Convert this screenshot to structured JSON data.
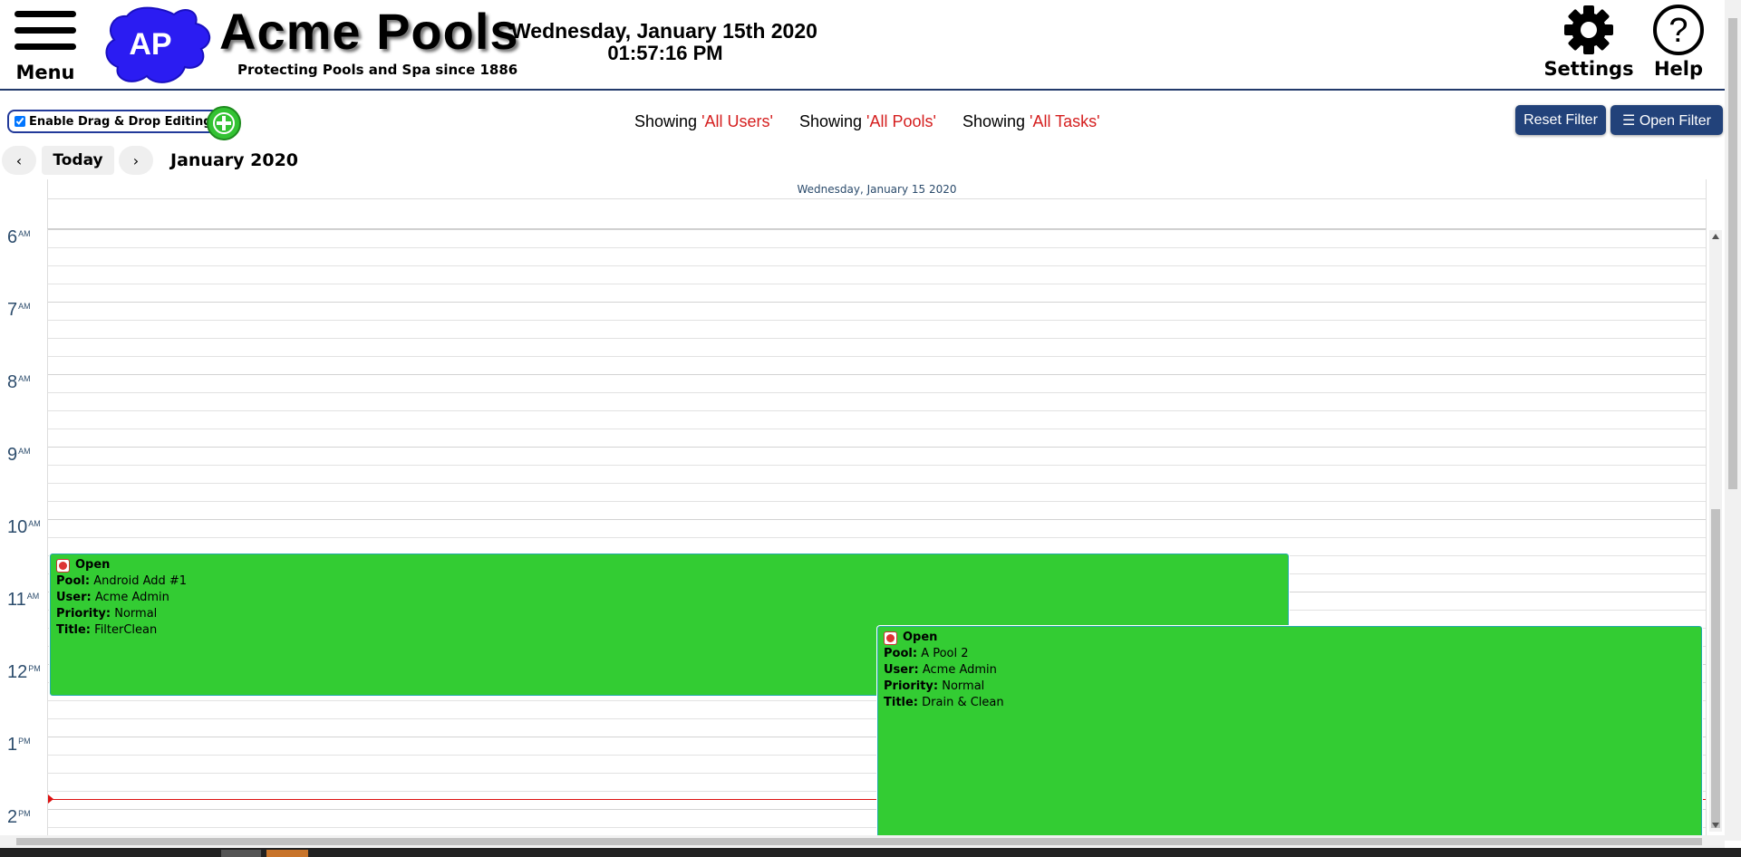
{
  "header": {
    "menu_label": "Menu",
    "logo_text": "AP",
    "brand_name": "Acme Pools",
    "brand_tagline": "Protecting Pools and Spa since 1886",
    "date": "Wednesday, January 15th 2020",
    "time": "01:57:16 PM",
    "settings_label": "Settings",
    "help_label": "Help"
  },
  "toolbar": {
    "drag_drop_label": "Enable Drag & Drop Editing",
    "drag_drop_checked": true,
    "filters": [
      {
        "prefix": "Showing ",
        "value": "'All Users'"
      },
      {
        "prefix": "Showing ",
        "value": "'All Pools'"
      },
      {
        "prefix": "Showing ",
        "value": "'All Tasks'"
      }
    ],
    "reset_filter_label": "Reset Filter",
    "open_filter_label": "☰ Open Filter"
  },
  "calendar": {
    "prev_label": "‹",
    "today_label": "Today",
    "next_label": "›",
    "month_title": "January 2020",
    "day_header": "Wednesday, January 15 2020",
    "hours": [
      {
        "num": "6",
        "suffix": "AM"
      },
      {
        "num": "7",
        "suffix": "AM"
      },
      {
        "num": "8",
        "suffix": "AM"
      },
      {
        "num": "9",
        "suffix": "AM"
      },
      {
        "num": "10",
        "suffix": "AM"
      },
      {
        "num": "11",
        "suffix": "AM"
      },
      {
        "num": "12",
        "suffix": "PM"
      },
      {
        "num": "1",
        "suffix": "PM"
      },
      {
        "num": "2",
        "suffix": "PM"
      }
    ],
    "events": [
      {
        "status": "Open",
        "pool_key": "Pool:",
        "pool": "Android Add #1",
        "user_key": "User:",
        "user": "Acme Admin",
        "priority_key": "Priority:",
        "priority": "Normal",
        "title_key": "Title:",
        "title": "FilterClean"
      },
      {
        "status": "Open",
        "pool_key": "Pool:",
        "pool": "A Pool 2",
        "user_key": "User:",
        "user": "Acme Admin",
        "priority_key": "Priority:",
        "priority": "Normal",
        "title_key": "Title:",
        "title": "Drain & Clean"
      }
    ]
  },
  "colors": {
    "accent": "#22427a",
    "event_green": "#33cc33",
    "filter_value_red": "#d51e1e",
    "now_line": "#dd1111"
  }
}
